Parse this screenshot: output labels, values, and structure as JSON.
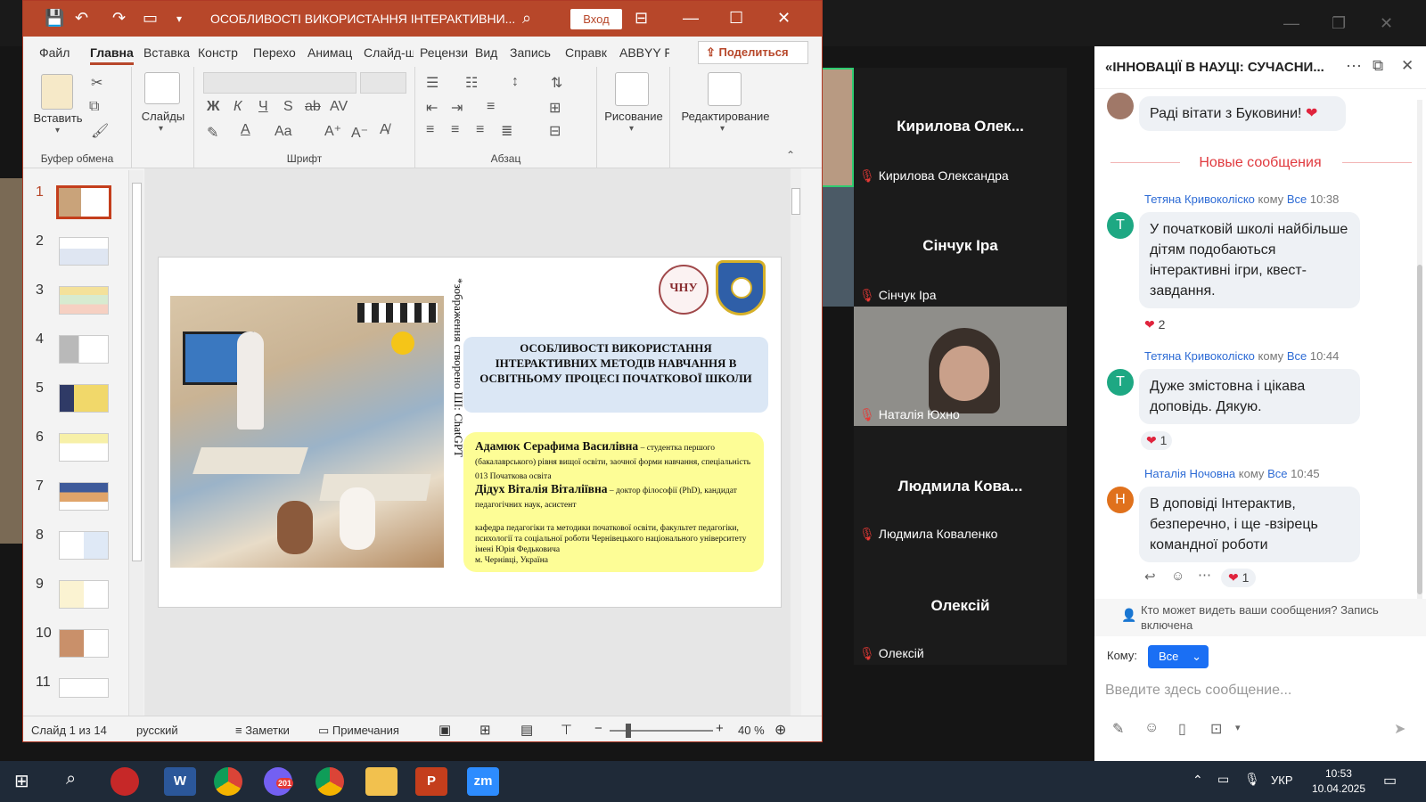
{
  "ppt": {
    "title": "ОСОБЛИВОСТІ ВИКОРИСТАННЯ ІНТЕРАКТИВНИ...",
    "sign_in": "Вход",
    "menu": [
      "Файл",
      "Главна",
      "Вставка",
      "Констр",
      "Перехо",
      "Анимац",
      "Слайд-ш",
      "Рецензи",
      "Вид",
      "Запись",
      "Справк",
      "ABBYY F"
    ],
    "share": "Поделиться",
    "ribbon": {
      "paste": "Вставить",
      "clipboard": "Буфер обмена",
      "slides": "Слайды",
      "font": "Шрифт",
      "paragraph": "Абзац",
      "drawing": "Рисование",
      "editing": "Редактирование",
      "bold": "Ж",
      "italic": "К",
      "underline": "Ч",
      "strike": "S",
      "font_size_up": "A",
      "font_case": "Aa"
    },
    "thumb_numbers": [
      "1",
      "2",
      "3",
      "4",
      "5",
      "6",
      "7",
      "8",
      "9",
      "10",
      "11"
    ],
    "selected_slide": 1,
    "slide": {
      "vertical_note": "*зображення створено ШІ: ChatGPT",
      "title": "ОСОБЛИВОСТІ ВИКОРИСТАННЯ ІНТЕРАКТИВНИХ МЕТОДІВ НАВЧАННЯ В ОСВІТНЬОМУ ПРОЦЕСІ ПОЧАТКОВОЇ ШКОЛИ",
      "author1_name": "Адамюк Серафима Василівна",
      "author1_desc": " – студентка першого (бакалаврського) рівня вищої освіти, заочної форми навчання, спеціальність 013 Початкова освіта",
      "author2_name": "Дідух Віталія Віталіївна",
      "author2_desc": " – доктор філософії (PhD), кандидат педагогічних наук, асистент",
      "dept": "кафедра педагогіки та методики початкової освіти, факультет педагогіки, психології та соціальної роботи Чернівецького національного університету імені Юрія Федьковича",
      "city": "м. Чернівці, Україна",
      "logo1_text": "ЧНУ"
    },
    "status": {
      "slide_of": "Слайд 1 из 14",
      "language": "русский",
      "notes": "Заметки",
      "comments": "Примечания",
      "zoom": "40 %"
    }
  },
  "gallery": [
    {
      "name": "Кирилова  Олек...",
      "label": "Кирилова Олександра"
    },
    {
      "name": "Сінчук Іра",
      "label": "Сінчук Іра"
    },
    {
      "name": "",
      "label": "Наталія Юхно"
    },
    {
      "name": "Людмила  Кова...",
      "label": "Людмила Коваленко"
    },
    {
      "name": "Олексій",
      "label": "Олексій"
    }
  ],
  "chat": {
    "title": "«ІННОВАЦІЇ В НАУЦІ: СУЧАСНИ...",
    "first_msg": "Раді вітати з Буковини!",
    "new_messages": "Новые сообщения",
    "messages": [
      {
        "initial": "Т",
        "sender": "Тетяна Кривоколіско",
        "to_word": "кому",
        "to": "Все",
        "time": "10:38",
        "text": "У початковій школі найбільше дітям подобаються інтерактивні ігри, квест- завдання.",
        "reactions": "2",
        "color": "#1ea883"
      },
      {
        "initial": "Т",
        "sender": "Тетяна Кривоколіско",
        "to_word": "кому",
        "to": "Все",
        "time": "10:44",
        "text": "Дуже змістовна і цікава доповідь. Дякую.",
        "reactions": "1",
        "color": "#1ea883"
      },
      {
        "initial": "Н",
        "sender": "Наталія Ночовна",
        "to_word": "кому",
        "to": "Все",
        "time": "10:45",
        "text": "В доповіді Інтерактив, безперечно, і ще -взірець командної роботи",
        "reactions": "1",
        "color": "#e0711c"
      }
    ],
    "privacy": "Кто может видеть ваши сообщения? Запись включена",
    "to_label": "Кому:",
    "to_value": "Все",
    "placeholder": "Введите здесь сообщение..."
  },
  "taskbar": {
    "time": "10:53",
    "date": "10.04.2025",
    "lang": "УКР",
    "viber_badge": "201",
    "zoom_label": "zm",
    "word_label": "W",
    "ppt_label": "P"
  },
  "colors": {
    "ppt_brand": "#b7472a",
    "zoom_blue": "#1a6ff4",
    "heart": "#e0243d"
  }
}
